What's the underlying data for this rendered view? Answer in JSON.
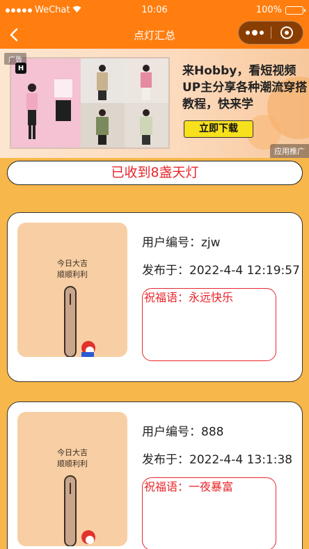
{
  "status_bar": {
    "carrier": "WeChat",
    "time": "10:06",
    "battery": "100%"
  },
  "nav": {
    "title": "点灯汇总"
  },
  "ad": {
    "tag": "广告",
    "brand_letter": "H",
    "headline": "来Hobby，看短视频UP主分享各种潮流穿搭教程，快来学",
    "cta_label": "立即下载",
    "label": "应用推广"
  },
  "summary": {
    "text": "已收到8盏天灯"
  },
  "entries": [
    {
      "user_label": "用户编号：",
      "user_id": "zjw",
      "time_label": "发布于：",
      "time": "2022-4-4 12:19:57",
      "wish_label": "祝福语：",
      "wish": "永远快乐",
      "thumb_line1": "今日大吉",
      "thumb_line2": "顺顺利利"
    },
    {
      "user_label": "用户编号：",
      "user_id": "888",
      "time_label": "发布于：",
      "time": "2022-4-4 13:1:38",
      "wish_label": "祝福语：",
      "wish": "一夜暴富",
      "thumb_line1": "今日大吉",
      "thumb_line2": "顺顺利利"
    }
  ],
  "colors": {
    "nav_bg": "#ff7e0f",
    "page_bg": "#f7b74a",
    "accent_red": "#e8262b",
    "cta_yellow": "#f7e01c"
  }
}
